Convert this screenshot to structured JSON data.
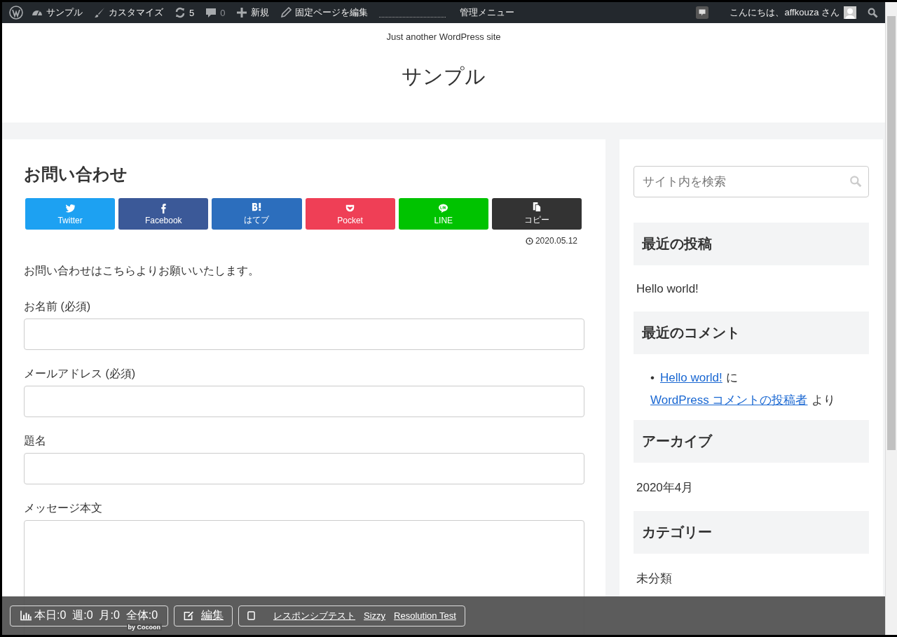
{
  "admin_bar": {
    "left": [
      {
        "kind": "logo"
      },
      {
        "kind": "dashboard",
        "label": "サンプル"
      },
      {
        "kind": "brush",
        "label": "カスタマイズ"
      },
      {
        "kind": "updates",
        "label": "5"
      },
      {
        "kind": "comments",
        "label": "0"
      },
      {
        "kind": "plus",
        "label": "新規"
      },
      {
        "kind": "pencil",
        "label": "固定ページを編集"
      },
      {
        "kind": "dotted"
      },
      {
        "kind": "text",
        "label": "管理メニュー"
      }
    ],
    "greeting": "こんにちは、affkouza さん"
  },
  "header": {
    "tagline": "Just another WordPress site",
    "site_title": "サンプル"
  },
  "article": {
    "title": "お問い合わせ",
    "share_buttons": [
      {
        "kind": "twitter",
        "label": "Twitter",
        "color": "#1da1f2"
      },
      {
        "kind": "facebook",
        "label": "Facebook",
        "color": "#3b5998"
      },
      {
        "kind": "hatena",
        "label": "はてブ",
        "color": "#2c6ebd"
      },
      {
        "kind": "pocket",
        "label": "Pocket",
        "color": "#ef3f56"
      },
      {
        "kind": "line",
        "label": "LINE",
        "color": "#00c300"
      },
      {
        "kind": "copy",
        "label": "コピー",
        "color": "#333333"
      }
    ],
    "date": "2020.05.12",
    "intro": "お問い合わせはこちらよりお願いいたします。",
    "fields": [
      {
        "kind": "input",
        "label": "お名前 (必須)"
      },
      {
        "kind": "input",
        "label": "メールアドレス (必須)"
      },
      {
        "kind": "input",
        "label": "題名"
      },
      {
        "kind": "textarea",
        "label": "メッセージ本文"
      }
    ]
  },
  "sidebar": {
    "search": {
      "placeholder": "サイト内を検索"
    },
    "widgets": [
      {
        "title": "最近の投稿",
        "kind": "links",
        "items": [
          "Hello world!"
        ]
      },
      {
        "title": "最近のコメント",
        "kind": "comments",
        "comments": [
          {
            "marker": "•",
            "post": "Hello world!",
            "on": "に",
            "author": "WordPress コメントの投稿者",
            "by": "より"
          }
        ]
      },
      {
        "title": "アーカイブ",
        "kind": "links",
        "items": [
          "2020年4月"
        ]
      },
      {
        "title": "カテゴリー",
        "kind": "links",
        "items": [
          "未分類"
        ]
      }
    ]
  },
  "footer_bar": {
    "counts": "本日:0  週:0  月:0  全体:0",
    "credit": "by Cocoon",
    "edit": "編集",
    "links": [
      "レスポンシブテスト",
      "Sizzy",
      "Resolution Test"
    ]
  }
}
